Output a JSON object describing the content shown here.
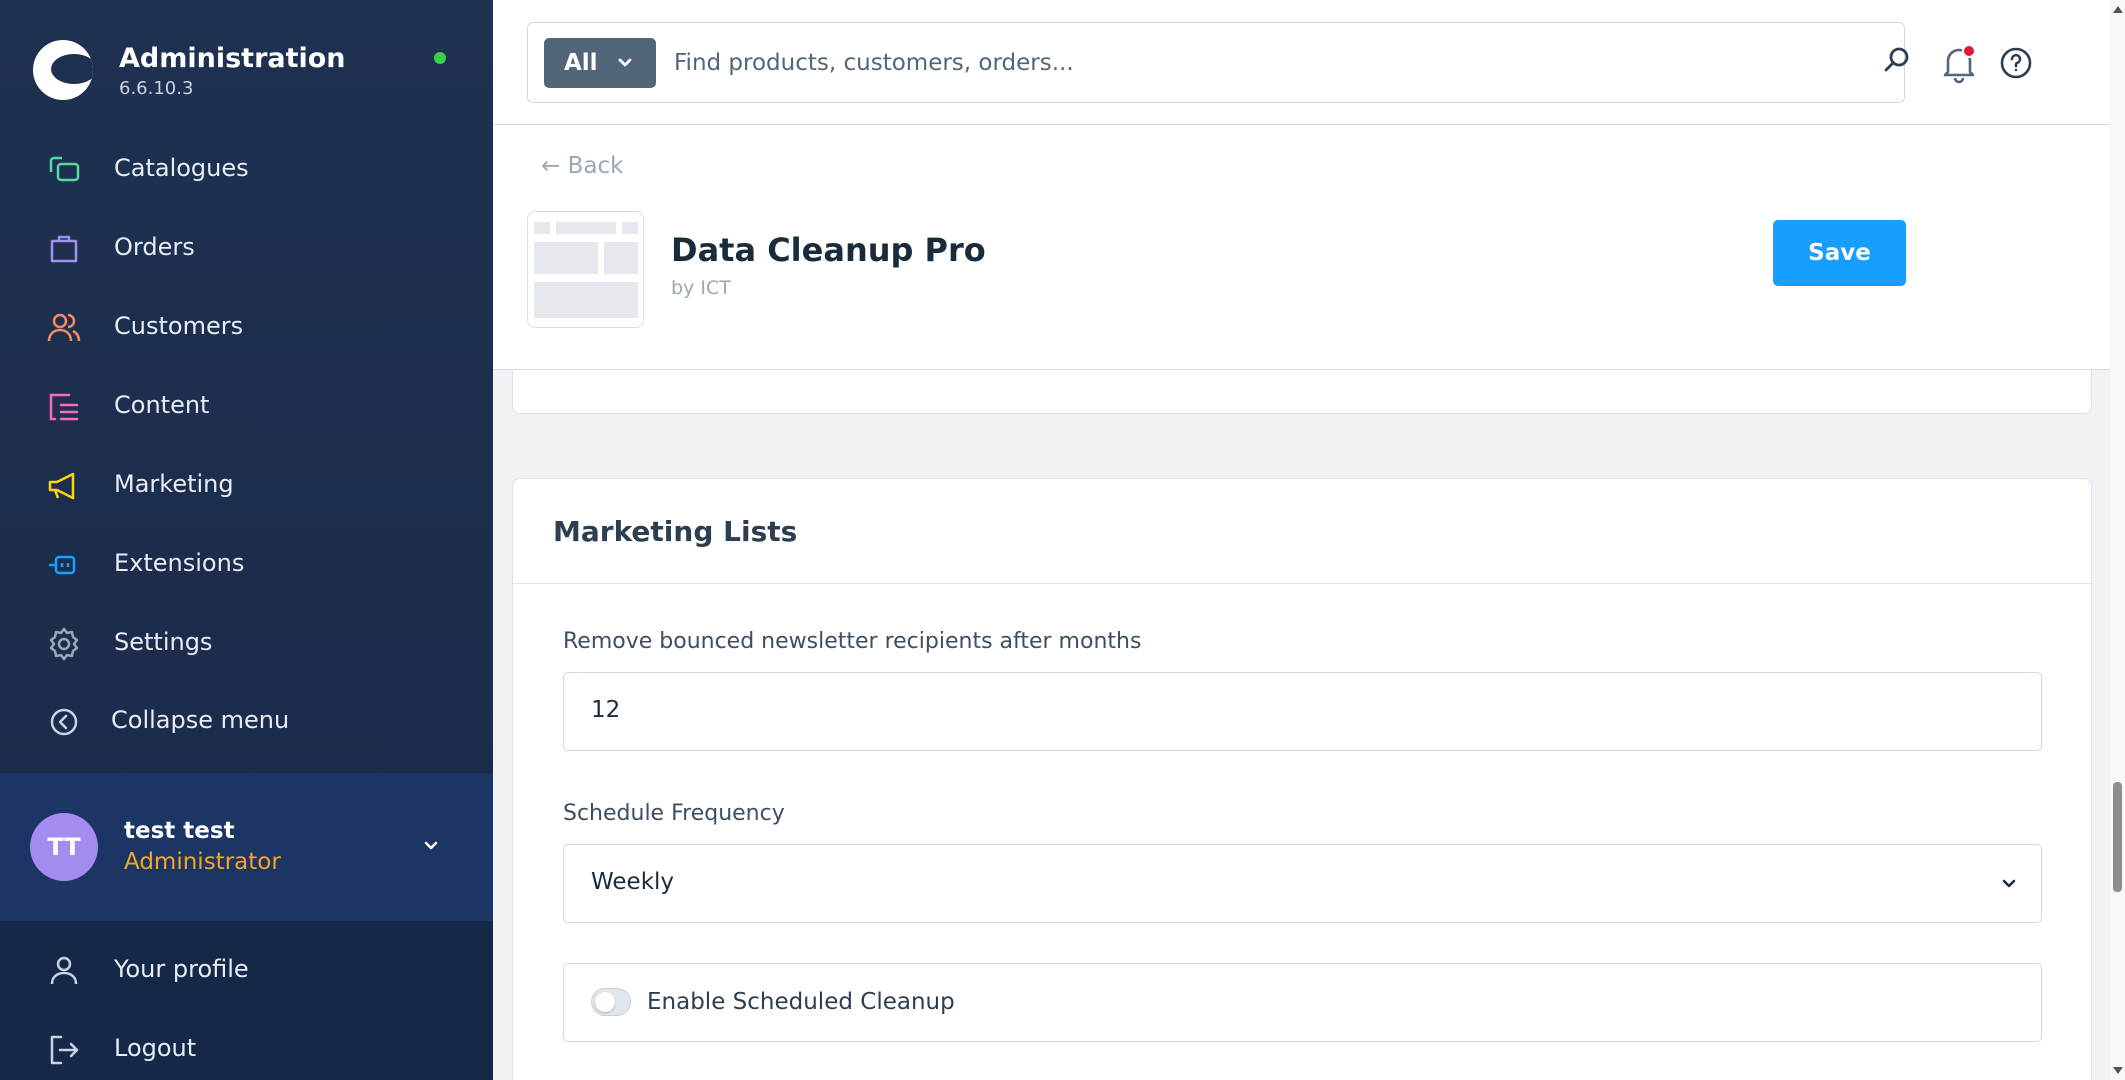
{
  "sidebar": {
    "brand_title": "Administration",
    "version": "6.6.10.3",
    "items": [
      {
        "label": "Catalogues",
        "icon": "catalogue-icon",
        "color": "#57d9a3"
      },
      {
        "label": "Orders",
        "icon": "orders-icon",
        "color": "#a092f0"
      },
      {
        "label": "Customers",
        "icon": "customers-icon",
        "color": "#f88962"
      },
      {
        "label": "Content",
        "icon": "content-icon",
        "color": "#ff68b4"
      },
      {
        "label": "Marketing",
        "icon": "marketing-icon",
        "color": "#ffd700"
      },
      {
        "label": "Extensions",
        "icon": "extensions-icon",
        "color": "#189eff"
      },
      {
        "label": "Settings",
        "icon": "settings-icon",
        "color": "#9aa8b5"
      }
    ],
    "collapse_label": "Collapse menu",
    "user": {
      "initials": "TT",
      "name": "test test",
      "role": "Administrator"
    },
    "profile_label": "Your profile",
    "logout_label": "Logout"
  },
  "topbar": {
    "search_scope": "All",
    "search_placeholder": "Find products, customers, orders..."
  },
  "header": {
    "back_label": "Back",
    "app_title": "Data Cleanup Pro",
    "app_author": "by ICT",
    "save_label": "Save"
  },
  "card": {
    "title": "Marketing Lists",
    "bounce_label": "Remove bounced newsletter recipients after months",
    "bounce_value": "12",
    "frequency_label": "Schedule Frequency",
    "frequency_value": "Weekly",
    "toggle_label": "Enable Scheduled Cleanup",
    "toggle_enabled": false
  },
  "colors": {
    "sidebar_bg": "#1f3151",
    "accent": "#189eff",
    "status_online": "#37d046",
    "role": "#f7a623"
  }
}
